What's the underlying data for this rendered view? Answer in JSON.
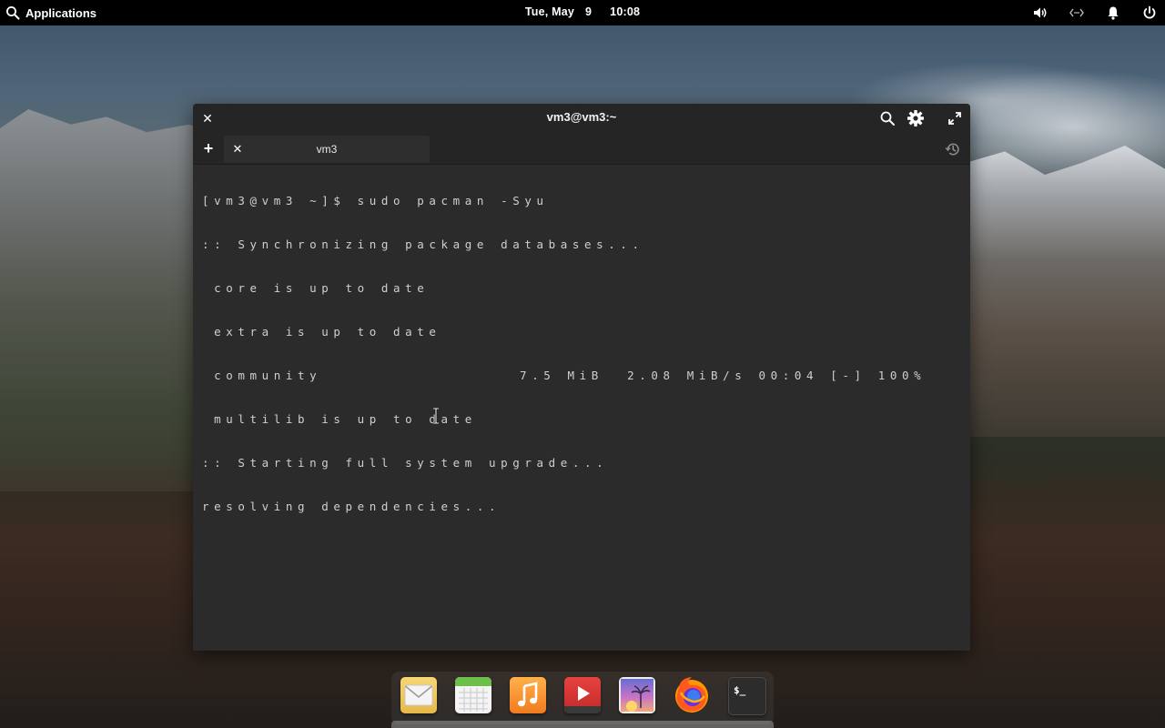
{
  "top_panel": {
    "applications_label": "Applications",
    "date": "Tue, May",
    "day": "9",
    "time": "10:08",
    "indicators": [
      "volume-icon",
      "network-icon",
      "notifications-icon",
      "power-icon"
    ]
  },
  "terminal": {
    "title": "vm3@vm3:~",
    "tabs": [
      {
        "label": "vm3"
      }
    ],
    "lines": [
      "[vm3@vm3 ~]$ sudo pacman -Syu",
      ":: Synchronizing package databases...",
      " core is up to date",
      " extra is up to date",
      " community",
      " multilib is up to date",
      ":: Starting full system upgrade...",
      "resolving dependencies..."
    ],
    "community_progress": "7.5 MiB  2.08 MiB/s 00:04 [-] 100%"
  },
  "dock": {
    "items": [
      {
        "name": "mail",
        "icon": "mail-icon"
      },
      {
        "name": "calendar",
        "icon": "calendar-icon"
      },
      {
        "name": "music",
        "icon": "music-icon"
      },
      {
        "name": "videos",
        "icon": "video-play-icon"
      },
      {
        "name": "photos",
        "icon": "photos-icon"
      },
      {
        "name": "firefox",
        "icon": "firefox-icon"
      },
      {
        "name": "terminal",
        "icon": "terminal-icon"
      }
    ],
    "terminal_prompt": "$_"
  },
  "colors": {
    "panel_bg": "#000000",
    "terminal_bg": "#2b2b2b",
    "terminal_text": "#cfcfcf",
    "titlebar_bg": "#252525"
  }
}
